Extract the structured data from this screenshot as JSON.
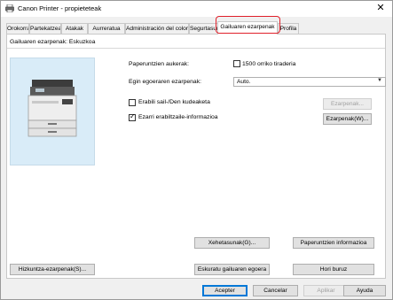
{
  "window": {
    "title": "Canon Printer - propieteteak",
    "close_glyph": "✕"
  },
  "tabs": [
    {
      "label": "Orokorra"
    },
    {
      "label": "Partekatzea"
    },
    {
      "label": "Atakak"
    },
    {
      "label": "Aurreratua"
    },
    {
      "label": "Administración del color"
    },
    {
      "label": "Segurtasuna"
    },
    {
      "label": "Gailuaren ezarpenak"
    },
    {
      "label": "Profila"
    }
  ],
  "active_tab": "Gailuaren ezarpenak",
  "highlight_color": "#e0202a",
  "panel": {
    "title": "Gailuaren ezarpenak: Eskuzkoa",
    "paper_source_label": "Paperuntzien aukerak:",
    "paper_source_value": "1500 orriko tiraderia",
    "output_label": "Egin egoeraren ezarpenak:",
    "output_value": "Auto.",
    "cb1_label": "Erabili sail-/Den kudeaketa",
    "cb1_checked": false,
    "btn_settings1": "Ezarpenak...",
    "cb2_label": "Ezarri erabiltzaile-informazioa",
    "cb2_checked": true,
    "btn_settings2": "Ezarpenak(W)...",
    "btn_get_device": "Xehetasunak(G)...",
    "btn_paper_info": "Paperuntzien informazioa",
    "btn_restore": "Hizkuntza-ezarpenak(S)...",
    "btn_get_settings": "Eskuratu gailuaren egoera",
    "btn_defaults": "Hori buruz"
  },
  "footer": {
    "ok": "Acepter",
    "cancel": "Cancelar",
    "apply": "Aplikar",
    "help": "Ayuda"
  }
}
